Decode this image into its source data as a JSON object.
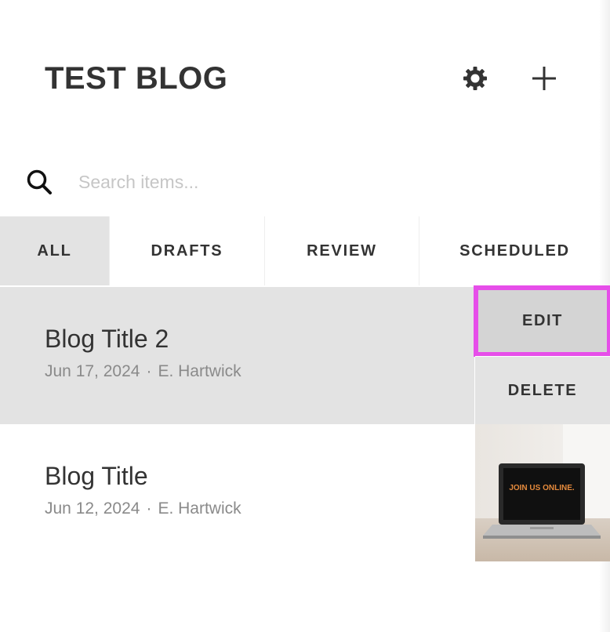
{
  "header": {
    "title": "TEST BLOG",
    "settings_icon": "gear-icon",
    "add_icon": "plus-icon"
  },
  "search": {
    "placeholder": "Search items...",
    "value": "",
    "icon": "search-icon"
  },
  "tabs": [
    {
      "label": "ALL",
      "active": true
    },
    {
      "label": "DRAFTS",
      "active": false
    },
    {
      "label": "REVIEW",
      "active": false
    },
    {
      "label": "SCHEDULED",
      "active": false
    }
  ],
  "posts": [
    {
      "title": "Blog Title 2",
      "date": "Jun 17, 2024",
      "author": "E. Hartwick",
      "selected": true
    },
    {
      "title": "Blog Title",
      "date": "Jun 12, 2024",
      "author": "E. Hartwick",
      "selected": false,
      "thumbnail_text": "JOIN US ONLINE."
    }
  ],
  "actions": {
    "edit_label": "EDIT",
    "delete_label": "DELETE"
  },
  "meta_separator": "·",
  "colors": {
    "active_tab_bg": "#e3e3e3",
    "selected_row_bg": "#e3e3e3",
    "highlight_outline": "#e64ee9",
    "text": "#333333",
    "meta_text": "#8a8a8a",
    "placeholder": "#c6c6c6"
  }
}
